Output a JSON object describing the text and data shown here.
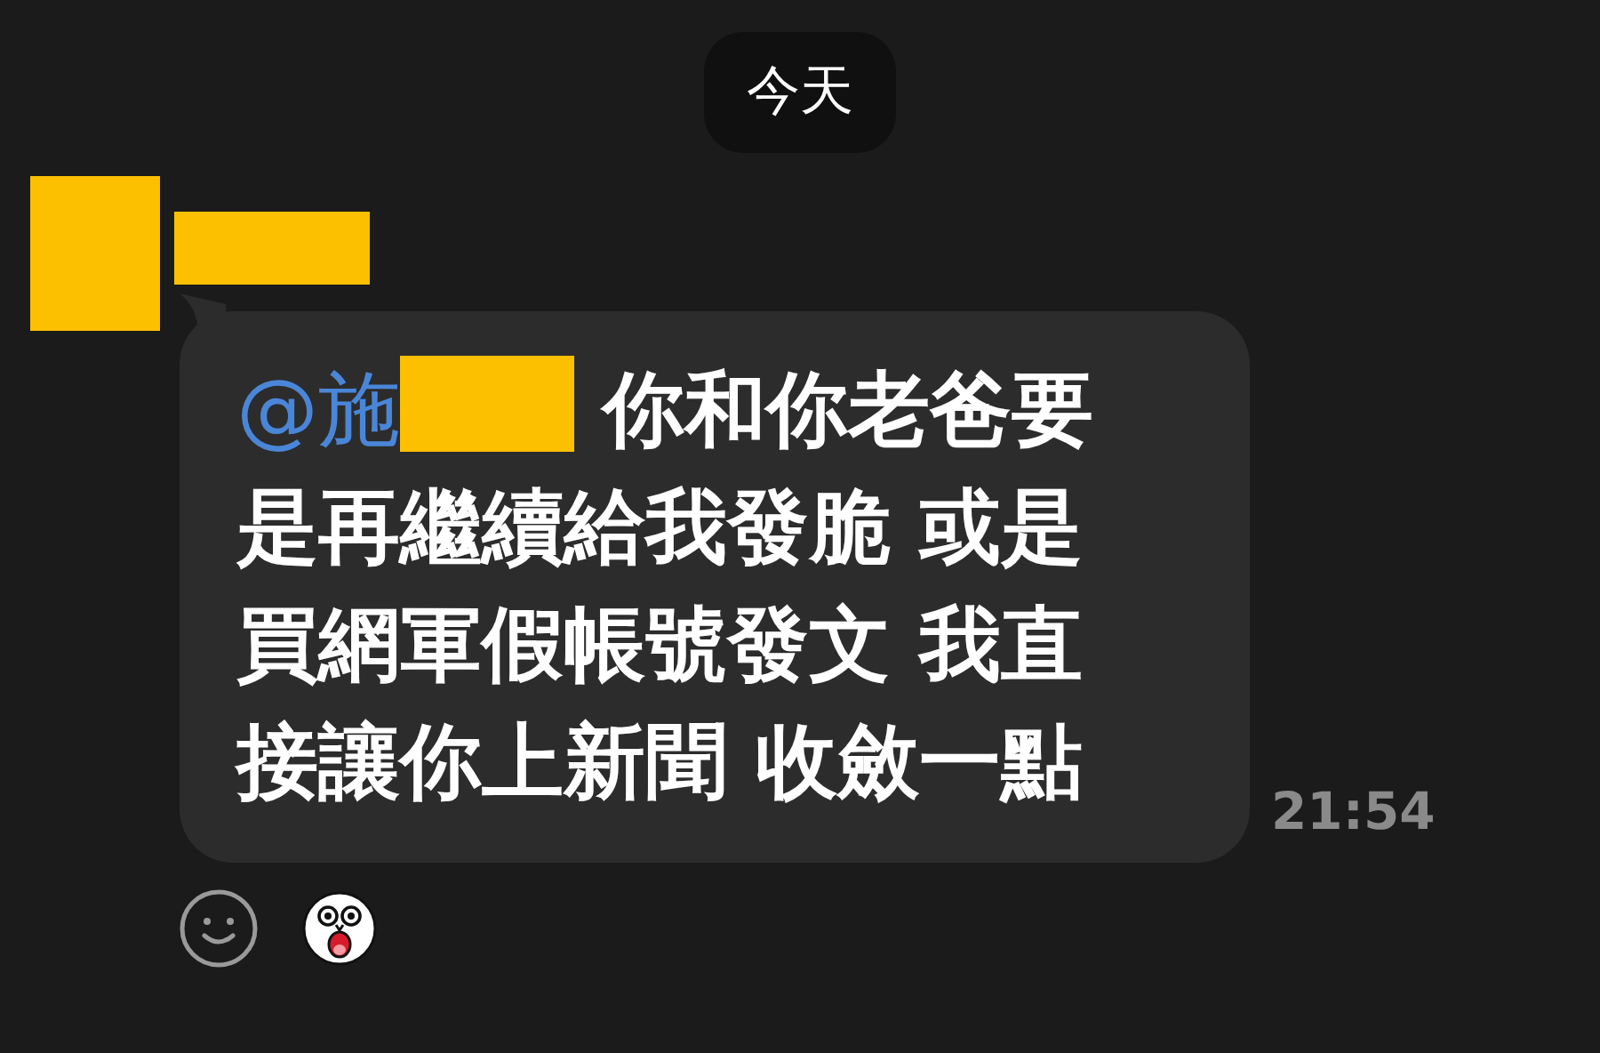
{
  "date_divider": {
    "label": "今天"
  },
  "message": {
    "mention": "@施",
    "lines": [
      " 你和你老爸要",
      "是再繼續給我發脆 或是",
      "買網軍假帳號發文 我直",
      "接讓你上新聞 收斂一點"
    ],
    "time": "21:54"
  }
}
